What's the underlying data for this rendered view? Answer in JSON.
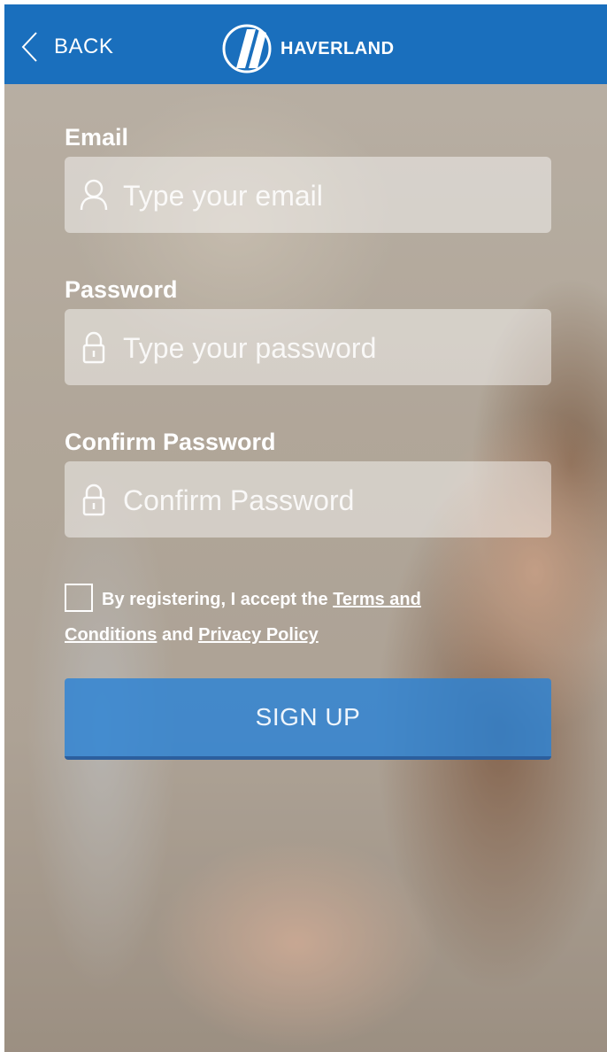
{
  "header": {
    "back_label": "BACK",
    "brand_name": "HAVERLAND",
    "color": "#1a6fbd"
  },
  "form": {
    "email": {
      "label": "Email",
      "placeholder": "Type your email",
      "icon": "user-icon"
    },
    "password": {
      "label": "Password",
      "placeholder": "Type your password",
      "icon": "lock-icon"
    },
    "confirm": {
      "label": "Confirm Password",
      "placeholder": "Confirm Password",
      "icon": "lock-icon"
    }
  },
  "terms": {
    "checked": false,
    "prefix": "By registering, I accept the ",
    "terms_link": "Terms and Conditions",
    "middle": " and ",
    "privacy_link": "Privacy Policy"
  },
  "signup": {
    "label": "SIGN UP",
    "color": "#2882d7"
  }
}
